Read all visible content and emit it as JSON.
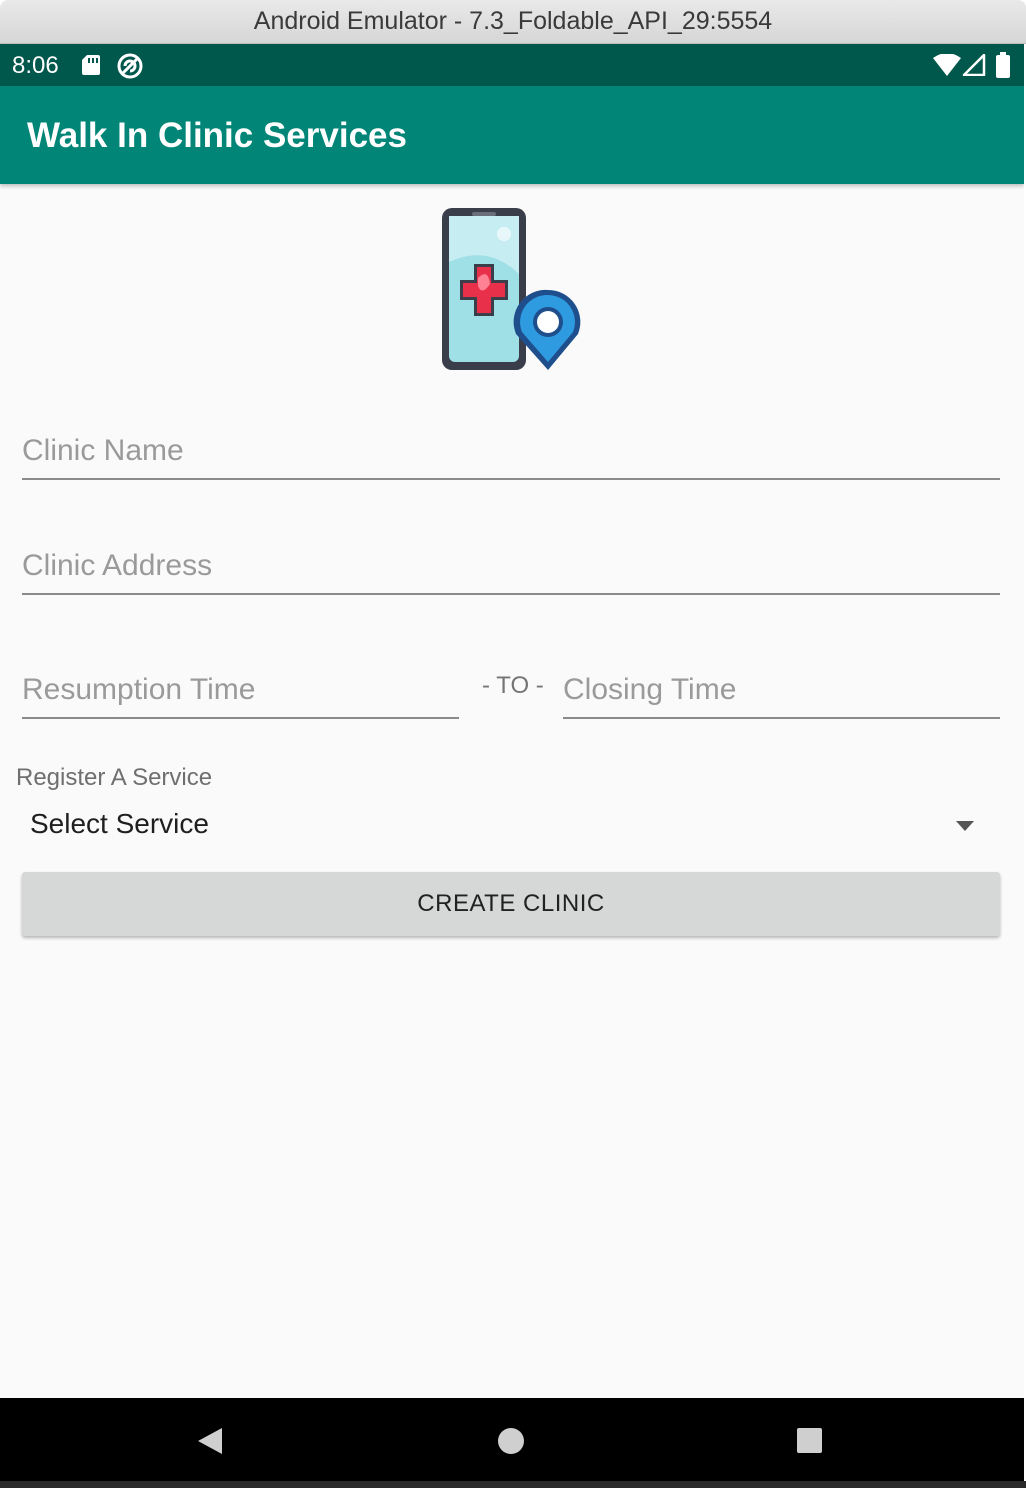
{
  "window": {
    "title": "Android Emulator - 7.3_Foldable_API_29:5554"
  },
  "status_bar": {
    "time": "8:06",
    "icons": [
      "sd-card-icon",
      "sync-icon",
      "wifi-icon",
      "cell-signal-icon",
      "battery-icon"
    ]
  },
  "app_bar": {
    "title": "Walk In Clinic Services"
  },
  "logo": {
    "icon": "phone-medical-location-icon"
  },
  "form": {
    "clinic_name_placeholder": "Clinic Name",
    "clinic_address_placeholder": "Clinic Address",
    "resumption_time_placeholder": "Resumption Time",
    "to_separator": "- TO -",
    "closing_time_placeholder": "Closing Time",
    "register_label": "Register A Service",
    "service_selected": "Select Service",
    "create_button": "CREATE CLINIC"
  },
  "nav_bar": {
    "icons": [
      "back-icon",
      "home-icon",
      "recents-icon"
    ]
  },
  "colors": {
    "status_bar": "#00574b",
    "app_bar": "#008577",
    "background": "#fafafa",
    "button": "#d6d7d7",
    "nav_bar": "#000000"
  }
}
